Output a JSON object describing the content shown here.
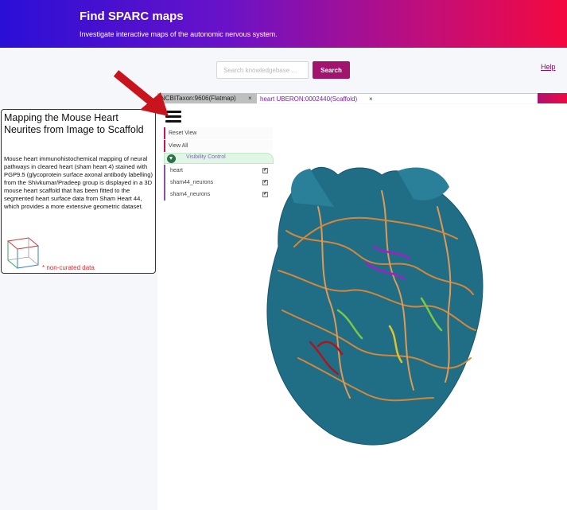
{
  "header": {
    "title": "Find SPARC maps",
    "subtitle": "Investigate interactive maps of the autonomic nervous system."
  },
  "search": {
    "placeholder": "Search knowledgebase ...",
    "button_label": "Search"
  },
  "help_label": "Help",
  "tabs": [
    {
      "label": "NCBITaxon:9606(Flatmap)",
      "close": "×"
    },
    {
      "label": "heart UBERON:0002440(Scaffold)",
      "close": "×"
    }
  ],
  "controls": {
    "reset_view": "Reset View",
    "view_all": "View All",
    "visibility_title": "Visibility Control",
    "layers": [
      {
        "label": "heart",
        "checked": true
      },
      {
        "label": "sham44_neurons",
        "checked": true
      },
      {
        "label": "sham4_neurons",
        "checked": true
      }
    ]
  },
  "card": {
    "title": "Mapping the Mouse Heart Neurites from Image to Scaffold",
    "description": "Mouse heart immunohistochemical mapping of neural pathways in cleared heart (sham heart 4) stained with PGP9.5 (glycoprotein surface axonal antibody labelling) from the Shivkumar/Pradeep group is displayed in a 3D mouse heart scaffold that has been fitted to the segmented heart surface data from Sham Heart 44, which provides a more extensive geometric dataset.",
    "note": "* non-curated data"
  },
  "colors": {
    "accent": "#a3146e",
    "heart": "#1f6e86",
    "neurites_sham44": "#d4873c",
    "neurites_sham4": "#a020c8",
    "arrow": "#c8141c"
  },
  "icons": [
    "hamburger-icon",
    "close-icon",
    "chevron-down-icon",
    "checkbox-icon",
    "cube-icon",
    "arrow-icon"
  ]
}
